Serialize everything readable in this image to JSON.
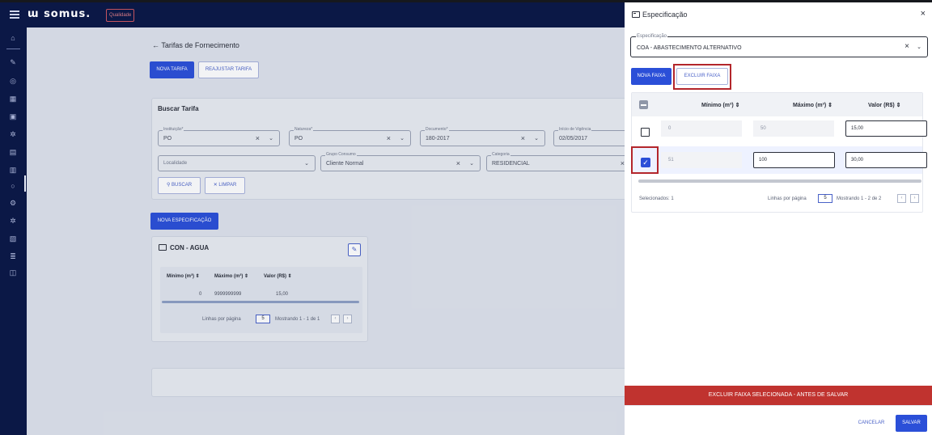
{
  "topbar": {
    "logo": "ɯ somus.",
    "environment_badge": "Qualidade"
  },
  "page": {
    "back_label": "← Tarifas de Fornecimento",
    "new_tariff_label": "NOVA TARIFA",
    "adjust_tariff_label": "REAJUSTAR TARIFA"
  },
  "search": {
    "title": "Buscar Tarifa",
    "fields": {
      "instituicao": {
        "label": "Instituição*",
        "value": "PO"
      },
      "natureza": {
        "label": "Natureza*",
        "value": "PO"
      },
      "documento": {
        "label": "Documento*",
        "value": "180-2017"
      },
      "inicio_vigencia": {
        "label": "Início de Vigência",
        "value": "02/05/2017"
      },
      "localidade": {
        "placeholder": "Localidade"
      },
      "grupo_consumo": {
        "label": "Grupo Consumo",
        "value": "Cliente Normal"
      },
      "categoria": {
        "label": "Categoria",
        "value": "RESIDENCIAL"
      }
    },
    "search_label": "BUSCAR",
    "clear_label": "LIMPAR"
  },
  "new_spec_label": "NOVA ESPECIFICAÇÃO",
  "spec_card": {
    "title": "CON - AGUA",
    "headers": [
      "Mínimo (m³) ⇕",
      "Máximo (m³) ⇕",
      "Valor (R$) ⇕"
    ],
    "row": [
      "0",
      "9999999999",
      "15,00"
    ],
    "rows_per_page_label": "Linhas por página",
    "rows_per_page": "5",
    "range_label": "Mostrando 1 - 1 de 1"
  },
  "drawer": {
    "title": "Especificação",
    "close": "×",
    "spec_field": {
      "label": "Especificação",
      "value": "COA - ABASTECIMENTO ALTERNATIVO"
    },
    "new_range_label": "NOVA FAIXA",
    "delete_range_label": "EXCLUIR FAIXA",
    "table": {
      "headers": {
        "min": "Mínimo (m³) ⇕",
        "max": "Máximo (m³) ⇕",
        "value": "Valor (R$) ⇕"
      },
      "rows": [
        {
          "min": "0",
          "max": "50",
          "value": "15,00",
          "selected": false
        },
        {
          "min": "51",
          "max": "100",
          "value": "30,00",
          "selected": true
        }
      ],
      "selected_label": "Selecionados: 1",
      "rows_per_page_label": "Linhas por página",
      "rows_per_page": "5",
      "range_label": "Mostrando 1 - 2 de 2"
    },
    "warning": "EXCLUIR FAIXA SELECIONADA - ANTES DE SALVAR",
    "cancel_label": "CANCELAR",
    "save_label": "SALVAR"
  },
  "colors": {
    "primary": "#2b4fd8",
    "nav_bg": "#0b1846",
    "warning": "#c0332f",
    "highlight_frame": "#b3262b"
  }
}
